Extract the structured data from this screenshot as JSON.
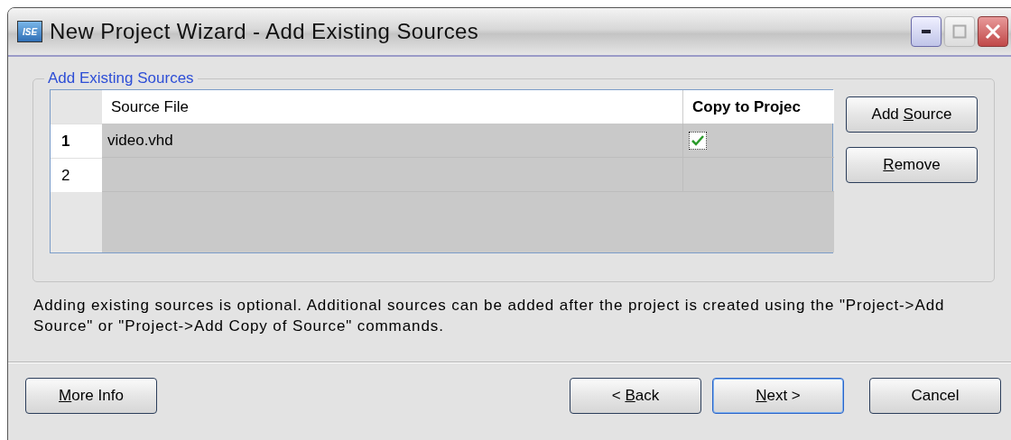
{
  "window": {
    "title": "New Project Wizard - Add Existing Sources",
    "app_icon": "ISE"
  },
  "group": {
    "title": "Add Existing Sources",
    "table": {
      "columns": [
        "Source File",
        "Copy to Projec"
      ],
      "rows": [
        {
          "number": "1",
          "source_file": "video.vhd",
          "copy": {
            "checked": true
          }
        },
        {
          "number": "2",
          "source_file": ""
        }
      ]
    },
    "buttons": [
      {
        "label_parts": [
          {
            "text": "Add "
          },
          {
            "text": "S",
            "underlined": true
          },
          {
            "text": "ource"
          }
        ]
      },
      {
        "label_parts": [
          {
            "text": "R",
            "underlined": true
          },
          {
            "text": "emove"
          }
        ]
      }
    ]
  },
  "description": "Adding existing sources is optional. Additional sources can be added after the project is created using the \"Project->Add Source\" or \"Project->Add Copy of Source\" commands.",
  "footer_buttons": [
    {
      "label_parts": [
        {
          "text": "M",
          "underlined": true
        },
        {
          "text": "ore Info"
        }
      ],
      "default": false
    },
    {
      "label_parts": [
        {
          "text": "< "
        },
        {
          "text": "B",
          "underlined": true
        },
        {
          "text": "ack"
        }
      ],
      "default": false
    },
    {
      "label_parts": [
        {
          "text": "N",
          "underlined": true
        },
        {
          "text": "ext >"
        }
      ],
      "default": true
    },
    {
      "label_parts": [
        {
          "text": "Cancel"
        }
      ],
      "default": false
    }
  ]
}
